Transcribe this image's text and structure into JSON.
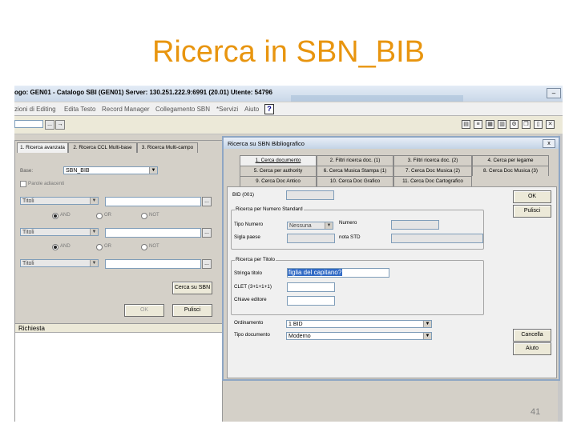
{
  "slide": {
    "title": "Ricerca in SBN_BIB",
    "page_number": "41"
  },
  "app": {
    "titlebar": "ogo: GEN01 - Catalogo SBI (GEN01) Server: 130.251.222.9:6991 (20.01) Utente: 54796",
    "menu": [
      "zioni di Editing",
      "Edita Testo",
      "Record Manager",
      "Collegamento SBN",
      "*Servizi",
      "Aiuto"
    ],
    "help_symbol": "?"
  },
  "left_panel": {
    "tabs": [
      "1. Ricerca avanzata",
      "2. Ricerca CCL Multi-base",
      "3. Ricerca Multi-campo"
    ],
    "base_label": "Base:",
    "base_value": "SBN_BIB",
    "parole_adiacenti": "Parole adiacenti",
    "field_select": "Titoli",
    "operators": [
      "AND",
      "OR",
      "NOT"
    ],
    "cerca_button": "Cerca su SBN",
    "ok_button": "OK",
    "pulisci_button": "Pulisci",
    "richiesta_label": "Richiesta",
    "ellipsis": "..."
  },
  "dialog": {
    "title": "Ricerca su SBN Bibliografico",
    "close": "x",
    "tabs_row1": [
      "1. Cerca documento",
      "2. Filtri ricerca doc. (1)",
      "3. Filtri ricerca doc. (2)",
      "4. Cerca per legame"
    ],
    "tabs_row2": [
      "5. Cerca per authority",
      "6. Cerca Musica Stampa (1)",
      "7. Cerca Doc Musica (2)",
      "8. Cerca Doc Musica (3)"
    ],
    "tabs_row3": [
      "9. Cerca Doc Antico",
      "10. Cerca Doc Grafico",
      "11. Cerca Doc Cartografico"
    ],
    "bid_label": "BID (001)",
    "numero_standard_group": "Ricerca per Numero Standard",
    "tipo_numero_label": "Tipo Numero",
    "tipo_numero_value": "Nessuna",
    "numero_label": "Numero",
    "sigla_paese_label": "Sigla paese",
    "nota_std_label": "nota STD",
    "titolo_group": "Ricerca per Titolo",
    "stringa_titolo_label": "Stringa titolo",
    "stringa_titolo_value": "figlia del capitano?",
    "clet_label": "CLET (3+1+1+1)",
    "chiave_editore_label": "Chiave editore",
    "ordinamento_label": "Ordinamento",
    "ordinamento_value": "1 BID",
    "tipo_documento_label": "Tipo documento",
    "tipo_documento_value": "Moderno",
    "ok_button": "OK",
    "pulisci_button": "Pulisci",
    "cancella_button": "Cancella",
    "aiuto_button": "Aiuto"
  }
}
